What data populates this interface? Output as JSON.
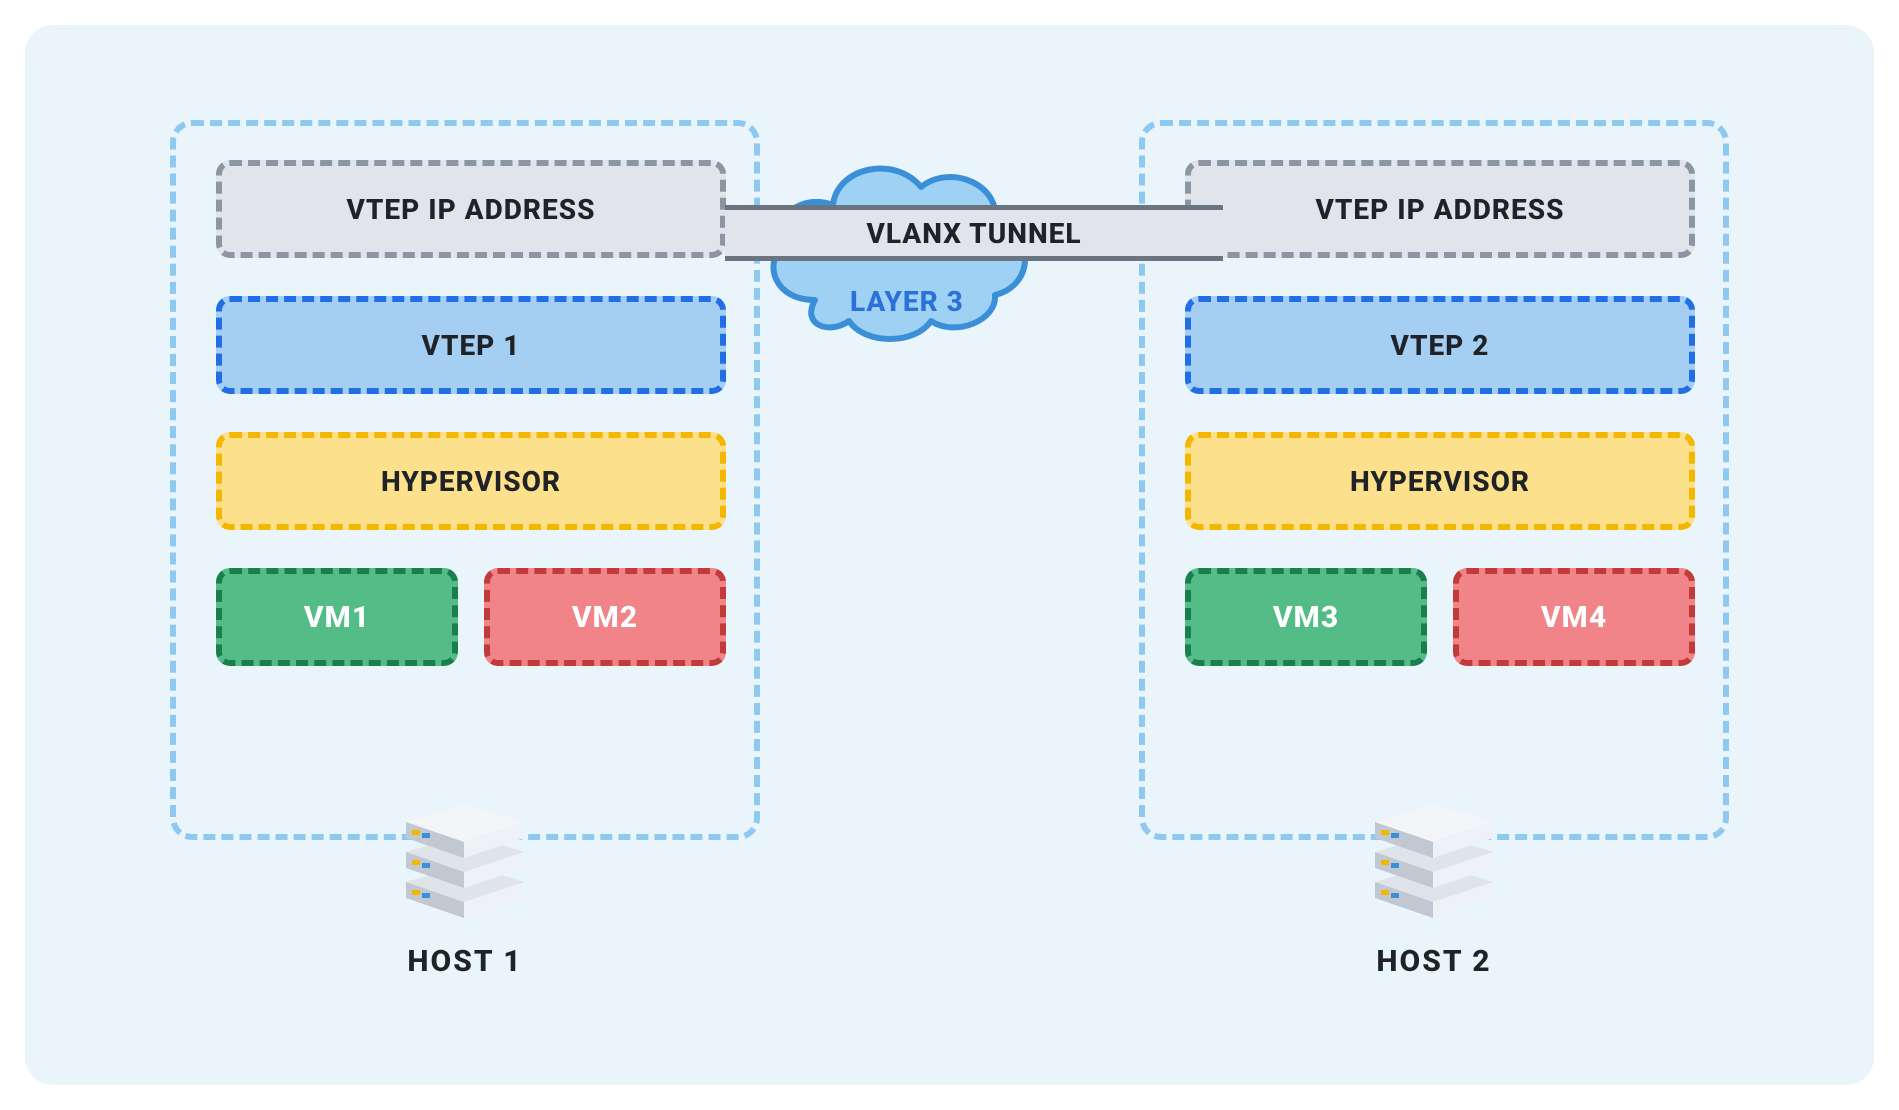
{
  "tunnel": {
    "label": "VLANX TUNNEL",
    "layer_label": "LAYER 3"
  },
  "hosts": [
    {
      "name": "HOST 1",
      "layers": {
        "vtep_ip": "VTEP IP ADDRESS",
        "vtep": "VTEP 1",
        "hypervisor": "HYPERVISOR"
      },
      "vms": [
        {
          "label": "VM1",
          "color": "green"
        },
        {
          "label": "VM2",
          "color": "red"
        }
      ]
    },
    {
      "name": "HOST 2",
      "layers": {
        "vtep_ip": "VTEP IP ADDRESS",
        "vtep": "VTEP 2",
        "hypervisor": "HYPERVISOR"
      },
      "vms": [
        {
          "label": "VM3",
          "color": "green"
        },
        {
          "label": "VM4",
          "color": "red"
        }
      ]
    }
  ],
  "colors": {
    "bg": "#e9f4fb",
    "host_border": "#8fc9ef",
    "vtep_ip_border": "#8d95a3",
    "vtep_ip_fill": "#e1e4ea",
    "vtep_border": "#226fe4",
    "vtep_fill": "#a5cef3",
    "hyper_border": "#f4b700",
    "hyper_fill": "#fde08b",
    "vm_green_border": "#1a7f4d",
    "vm_green_fill": "#54bd87",
    "vm_red_border": "#c23b3b",
    "vm_red_fill": "#f08489",
    "cloud_fill": "#9fd1f4",
    "cloud_stroke": "#3b8fd8",
    "layer3_text": "#2a72d9"
  }
}
